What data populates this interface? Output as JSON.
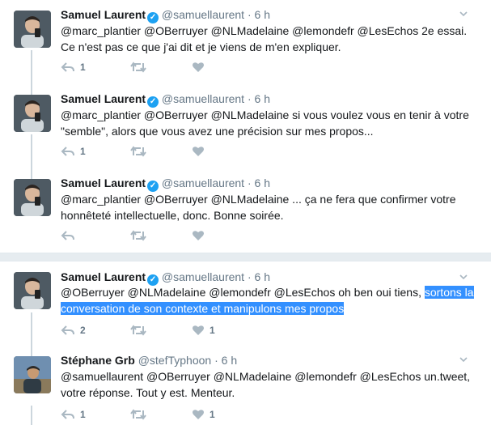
{
  "tweets": [
    {
      "name": "Samuel Laurent",
      "handle": "@samuellaurent",
      "time": "6 h",
      "verified": true,
      "text": "@marc_plantier @OBerruyer @NLMadelaine @lemondefr @LesEchos 2e essai. Ce n'est pas ce que j'ai dit et je viens de m'en expliquer.",
      "replies": "1",
      "retweets": "",
      "likes": ""
    },
    {
      "name": "Samuel Laurent",
      "handle": "@samuellaurent",
      "time": "6 h",
      "verified": true,
      "text": "@marc_plantier @OBerruyer @NLMadelaine si vous voulez vous en tenir à votre \"semble\", alors que vous avez une précision sur mes propos...",
      "replies": "1",
      "retweets": "",
      "likes": ""
    },
    {
      "name": "Samuel Laurent",
      "handle": "@samuellaurent",
      "time": "6 h",
      "verified": true,
      "text": "@marc_plantier @OBerruyer @NLMadelaine ... ça ne fera que confirmer votre honnêteté intellectuelle, donc. Bonne soirée.",
      "replies": "",
      "retweets": "",
      "likes": ""
    },
    {
      "name": "Samuel Laurent",
      "handle": "@samuellaurent",
      "time": "6 h",
      "verified": true,
      "text_plain": "@OBerruyer @NLMadelaine @lemondefr @LesEchos oh ben oui tiens, ",
      "text_highlight": "sortons la conversation de son contexte et manipulons mes propos",
      "replies": "2",
      "retweets": "",
      "likes": "1"
    },
    {
      "name": "Stéphane Grb",
      "handle": "@stefTyphoon",
      "time": "6 h",
      "verified": false,
      "text": "@samuellaurent @OBerruyer @NLMadelaine @lemondefr @LesEchos un.tweet, votre réponse. Tout y est. Menteur.",
      "replies": "1",
      "retweets": "",
      "likes": "1"
    }
  ],
  "dot": "·",
  "colors": {
    "accent": "#1da1f2",
    "icon": "#aab8c2",
    "thread": "#ccd6dd",
    "highlight": "#3390ff"
  },
  "icons": [
    "reply-icon",
    "retweet-icon",
    "heart-icon",
    "chevron-down-icon",
    "verified-badge-icon"
  ]
}
